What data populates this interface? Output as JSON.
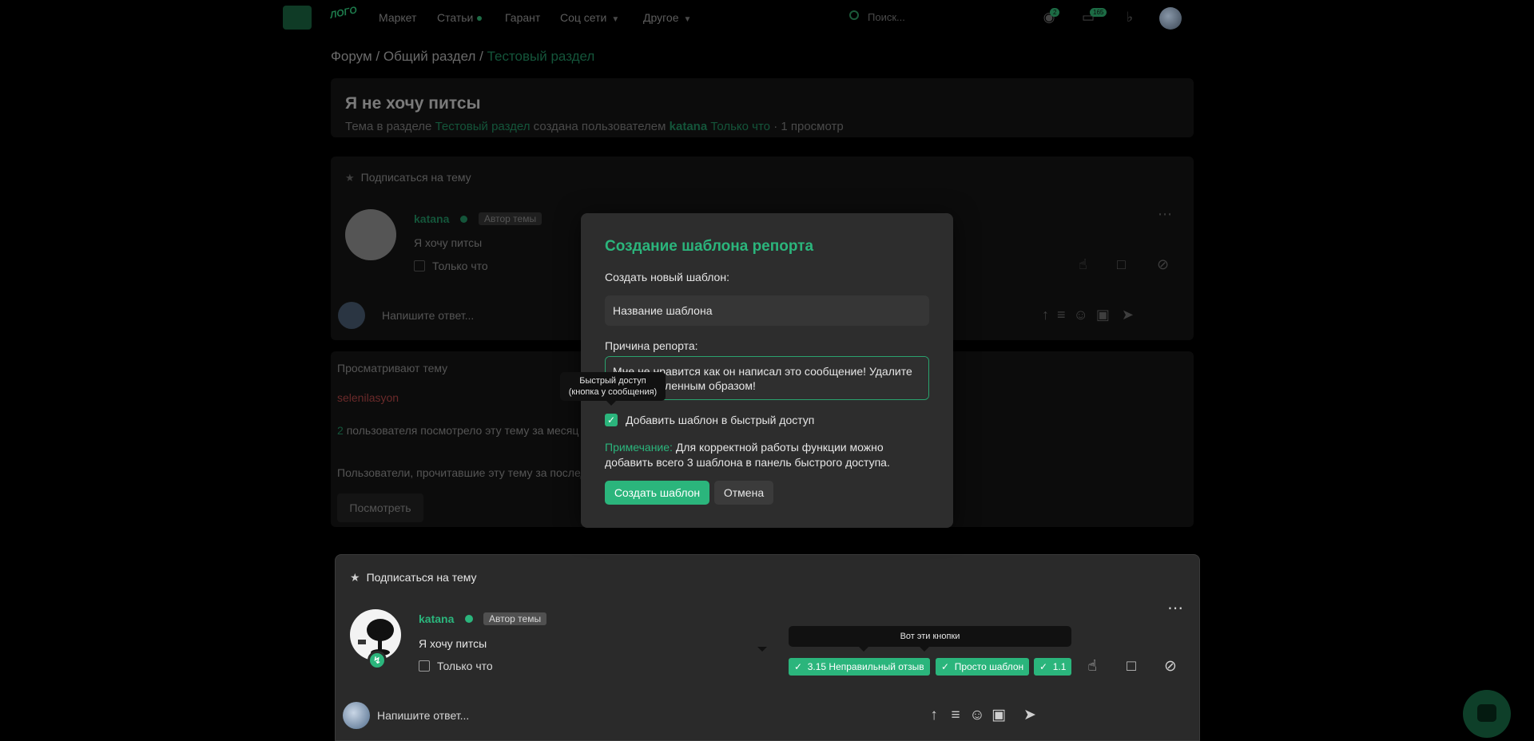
{
  "nav": {
    "items": [
      {
        "label": "Маркет"
      },
      {
        "label": "Статьи"
      },
      {
        "label": "Гарант"
      },
      {
        "label": "Соц сети"
      },
      {
        "label": "Другое"
      }
    ],
    "search_placeholder": "Поиск...",
    "notif_count_1": "2",
    "notif_count_2": "165"
  },
  "breadcrumb": [
    "Форум",
    "/",
    "Общий раздел",
    "/",
    "Тестовый раздел"
  ],
  "thread": {
    "title": "Я не хочу питсы",
    "meta_prefix": "Тема в разделе",
    "meta_section": "Тестовый раздел",
    "meta_mid": "создана пользователем",
    "meta_author": "katana",
    "meta_time": "Только что",
    "meta_suffix": "· 1 просмотр",
    "viewers_title": "Просматривают тему",
    "viewers_names": "selenilasyon",
    "views_count": "2",
    "views_text": "пользователя посмотрело эту тему за месяц",
    "readers_text": "Пользователи, прочитавшие эту тему за последн",
    "view_button": "Посмотреть"
  },
  "modal": {
    "title": "Создание шаблона репорта",
    "new_label": "Создать новый шаблон:",
    "name_value": "Название шаблона",
    "reason_label": "Причина репорта:",
    "reason_value": "Мне не нравится как он написал это сообщение! Удалите его немедленным образом!",
    "checkbox_label": "Добавить шаблон в быстрый доступ",
    "note_label": "Примечание:",
    "note_text": " Для корректной работы функции можно добавить всего 3 шаблона в панель быстрого доступа.",
    "create_button": "Создать шаблон",
    "cancel_button": "Отмена",
    "tooltip_line1": "Быстрый доступ",
    "tooltip_line2": "(кнопка у сообщения)"
  },
  "card": {
    "subscribe": "Подписаться на тему",
    "author": "katana",
    "author_badge": "Автор темы",
    "post_text": "Я хочу питсы",
    "only_label": "Только что",
    "tooltip": "Вот эти кнопки",
    "templates": [
      "3.15 Неправильный отзыв",
      "Просто шаблон",
      "1.1"
    ],
    "reply_placeholder": "Напишите ответ..."
  },
  "colors": {
    "accent": "#2bb57c",
    "modal_bg": "#2d2d2d",
    "card_bg": "#2a2a2a"
  }
}
